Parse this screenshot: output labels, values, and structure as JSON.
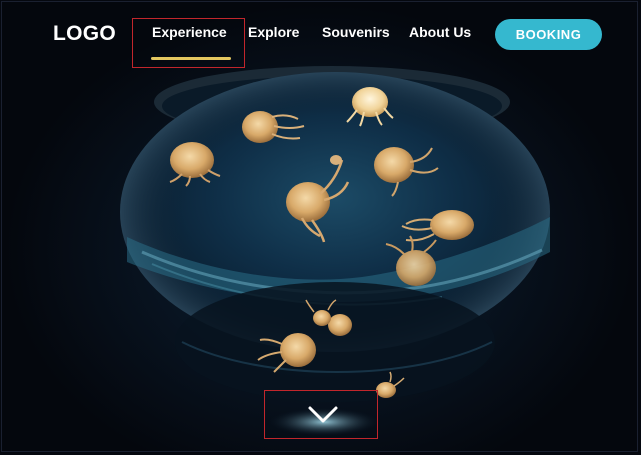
{
  "header": {
    "logo": "LOGO",
    "nav": [
      {
        "label": "Experience",
        "active": true
      },
      {
        "label": "Explore"
      },
      {
        "label": "Souvenirs"
      },
      {
        "label": "About Us"
      }
    ],
    "cta_label": "BOOKING"
  },
  "colors": {
    "background": "#05080f",
    "accent": "#35b8cf",
    "active_underline": "#e4c760",
    "annotation_box": "#c2262c"
  },
  "hero": {
    "image": "jellyfish aquarium",
    "scroll_icon": "chevron-down-icon"
  }
}
